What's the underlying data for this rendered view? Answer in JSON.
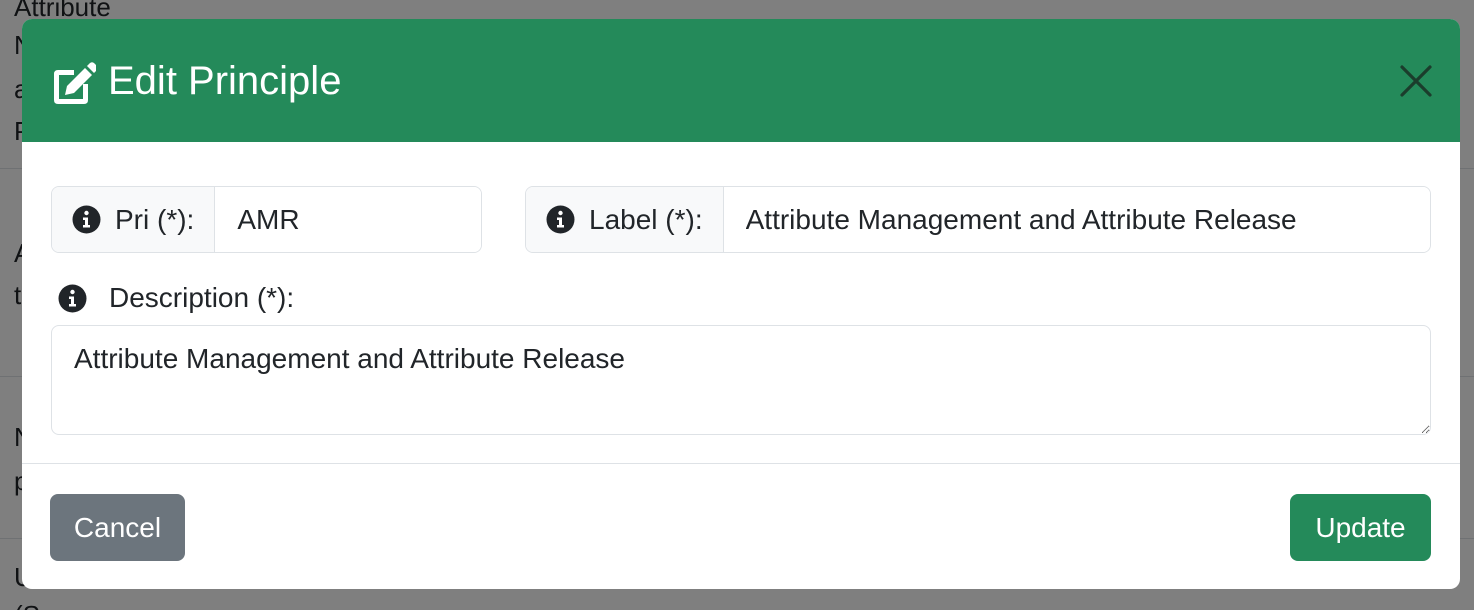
{
  "background": {
    "lines": [
      "Attribute",
      "N",
      "a",
      "P",
      "A",
      "t",
      "N",
      "p",
      "U",
      "(S"
    ]
  },
  "modal": {
    "title": "Edit Principle",
    "close_icon": "close-icon",
    "fields": {
      "pri": {
        "label": "Pri (*):",
        "value": "AMR",
        "icon": "info-icon"
      },
      "label": {
        "label": "Label (*):",
        "value": "Attribute Management and Attribute Release",
        "icon": "info-icon"
      },
      "description": {
        "label": "Description (*):",
        "value": "Attribute Management and Attribute Release",
        "icon": "info-icon"
      }
    },
    "buttons": {
      "cancel": "Cancel",
      "update": "Update"
    },
    "colors": {
      "header": "#248a5a",
      "primary": "#248a5a",
      "secondary": "#6c757d"
    }
  }
}
